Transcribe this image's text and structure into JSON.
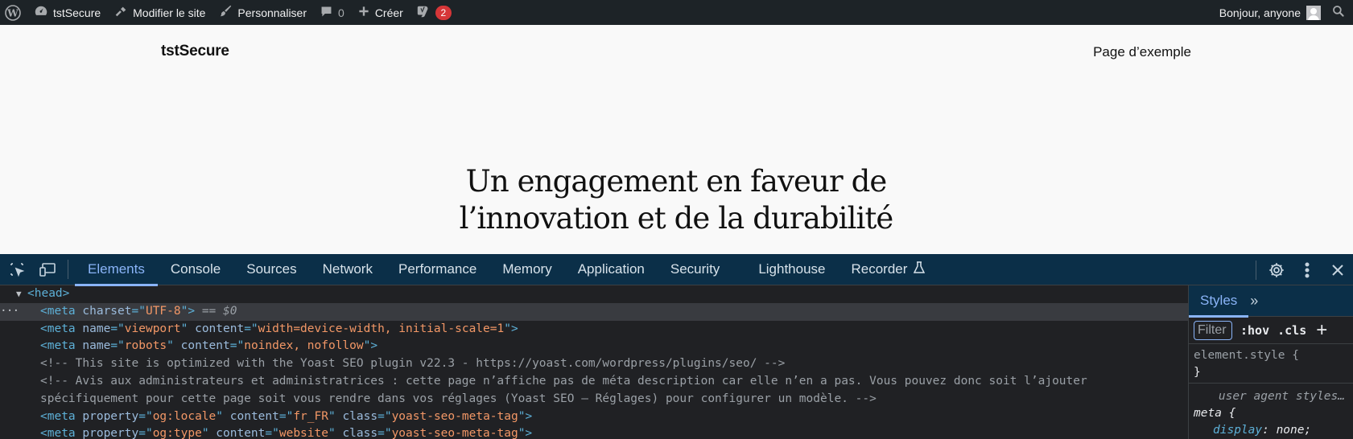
{
  "adminbar": {
    "site_name": "tstSecure",
    "edit_site": "Modifier le site",
    "customize": "Personnaliser",
    "comments_count": "0",
    "new_label": "Créer",
    "yoast_badge": "2",
    "greeting": "Bonjour, anyone"
  },
  "site": {
    "title": "tstSecure",
    "nav_item": "Page d’exemple",
    "hero_line1": "Un engagement en faveur de",
    "hero_line2": "l’innovation et de la durabilité"
  },
  "devtools": {
    "tabs": [
      "Elements",
      "Console",
      "Sources",
      "Network",
      "Performance",
      "Memory",
      "Application",
      "Security",
      "Lighthouse",
      "Recorder"
    ],
    "active_tab": "Elements",
    "dom": {
      "head": "<head>",
      "sel_equals": "== $0",
      "meta1": {
        "attr": "charset",
        "val": "UTF-8"
      },
      "meta2": {
        "attr1": "name",
        "val1": "viewport",
        "attr2": "content",
        "val2": "width=device-width, initial-scale=1"
      },
      "meta3": {
        "attr1": "name",
        "val1": "robots",
        "attr2": "content",
        "val2": "noindex, nofollow"
      },
      "comment1": "<!-- This site is optimized with the Yoast SEO plugin v22.3 - https://yoast.com/wordpress/plugins/seo/ -->",
      "comment2": "<!-- Avis aux administrateurs et administratrices : cette page n’affiche pas de méta description car elle n’en a pas. Vous pouvez donc soit l’ajouter spécifiquement pour cette page soit vous rendre dans vos réglages (Yoast SEO – Réglages) pour configurer un modèle. -->",
      "meta4": {
        "attr1": "property",
        "val1": "og:locale",
        "attr2": "content",
        "val2": "fr_FR",
        "attr3": "class",
        "val3": "yoast-seo-meta-tag"
      },
      "meta5": {
        "attr1": "property",
        "val1": "og:type",
        "attr2": "content",
        "val2": "website",
        "attr3": "class",
        "val3": "yoast-seo-meta-tag"
      }
    },
    "styles": {
      "tab": "Styles",
      "filter_placeholder": "Filter",
      "hov": ":hov",
      "cls": ".cls",
      "element_style": "element.style {",
      "close_brace": "}",
      "user_agent": "user agent styles…",
      "meta_selector": "meta {",
      "display_prop": "display",
      "display_val": ": none;"
    }
  }
}
